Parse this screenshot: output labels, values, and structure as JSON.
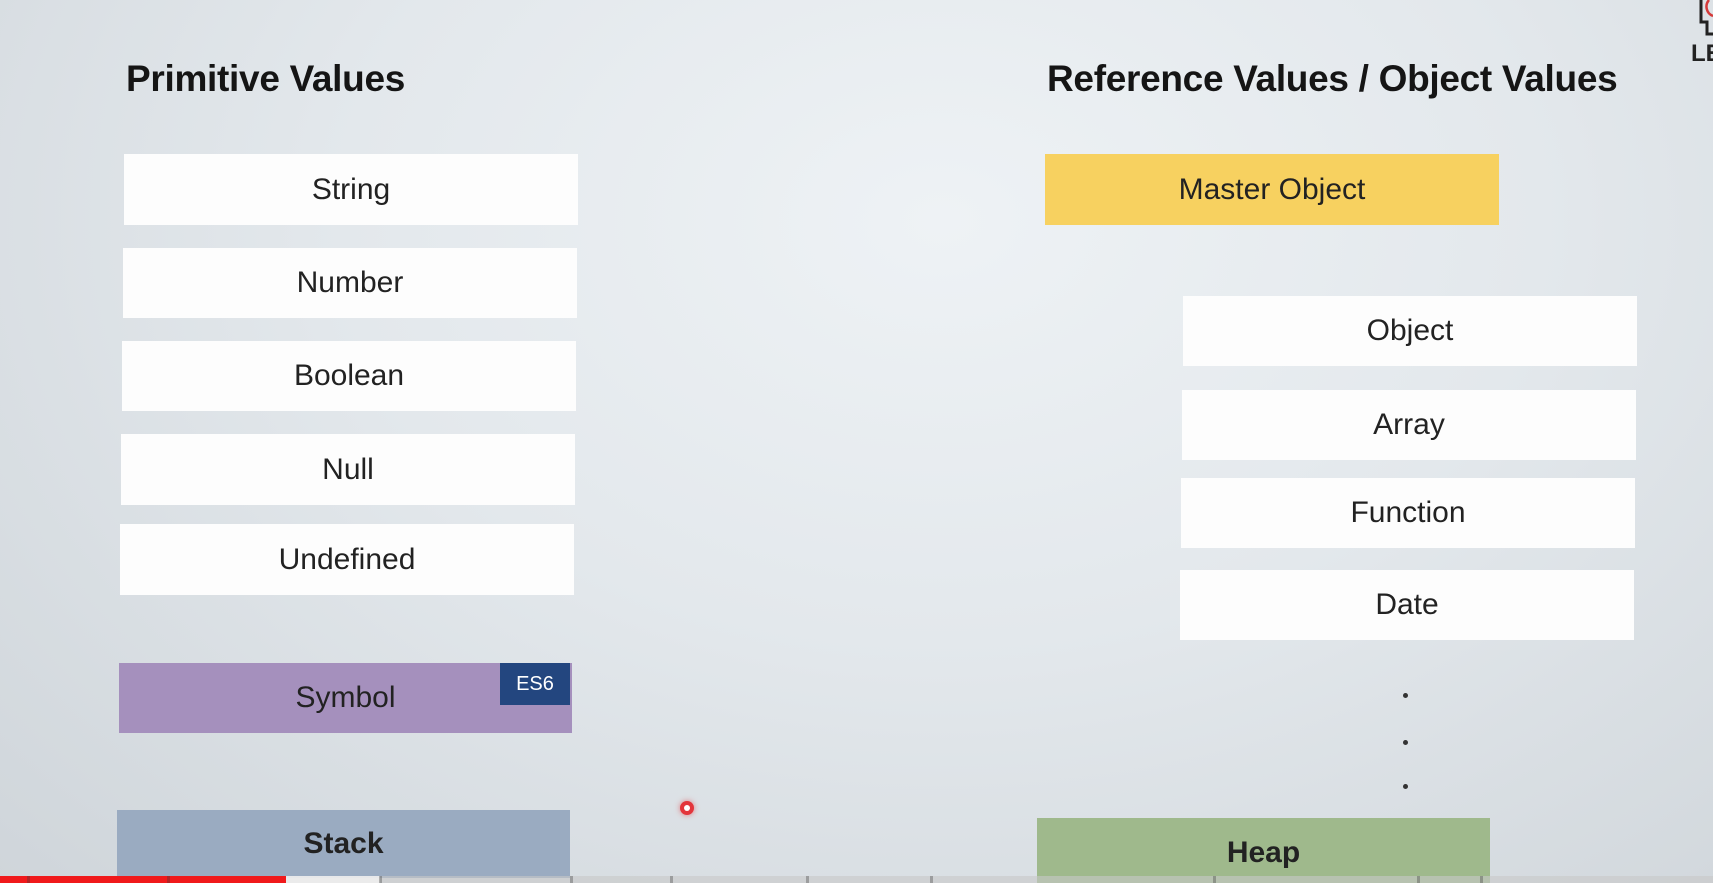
{
  "primitive": {
    "title": "Primitive Values",
    "items": [
      "String",
      "Number",
      "Boolean",
      "Null",
      "Undefined"
    ],
    "symbol": "Symbol",
    "symbol_badge": "ES6",
    "stack": "Stack"
  },
  "reference": {
    "title": "Reference Values / Object Values",
    "master": "Master Object",
    "items": [
      "Object",
      "Array",
      "Function",
      "Date"
    ],
    "heap": "Heap"
  },
  "logo": {
    "text": "LE"
  },
  "colors": {
    "master": "#f7d160",
    "symbol": "#a590bd",
    "badge": "#23467f",
    "stack": "#9aabc1",
    "heap": "#9fb98c",
    "progress": "#f0191b"
  },
  "icons": [
    "cursor-highlight-icon",
    "channel-logo-icon"
  ],
  "video": {
    "progress_fraction": 0.167
  }
}
